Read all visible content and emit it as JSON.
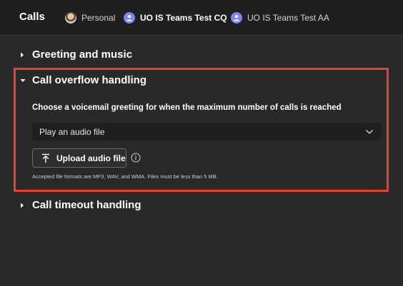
{
  "header": {
    "title": "Calls",
    "accounts": [
      {
        "label": "Personal",
        "icon": "person-avatar"
      },
      {
        "label": "UO IS Teams Test CQ",
        "icon": "team-avatar-icon"
      },
      {
        "label": "UO IS Teams Test AA",
        "icon": "team-avatar-icon"
      }
    ]
  },
  "sections": {
    "greeting": {
      "title": "Greeting and music",
      "expanded": false
    },
    "overflow": {
      "title": "Call overflow handling",
      "expanded": true,
      "prompt": "Choose a voicemail greeting for when the maximum number of calls is reached",
      "select_value": "Play an audio file",
      "upload_label": "Upload audio file",
      "note": "Accepted file formats are MP3, WAV, and WMA. Files must be less than 5 MB."
    },
    "timeout": {
      "title": "Call timeout handling",
      "expanded": false
    }
  },
  "colors": {
    "background": "#292929",
    "topbar": "#1f1f1f",
    "highlight": "#e8402d",
    "team_avatar": "#7f85f5"
  }
}
